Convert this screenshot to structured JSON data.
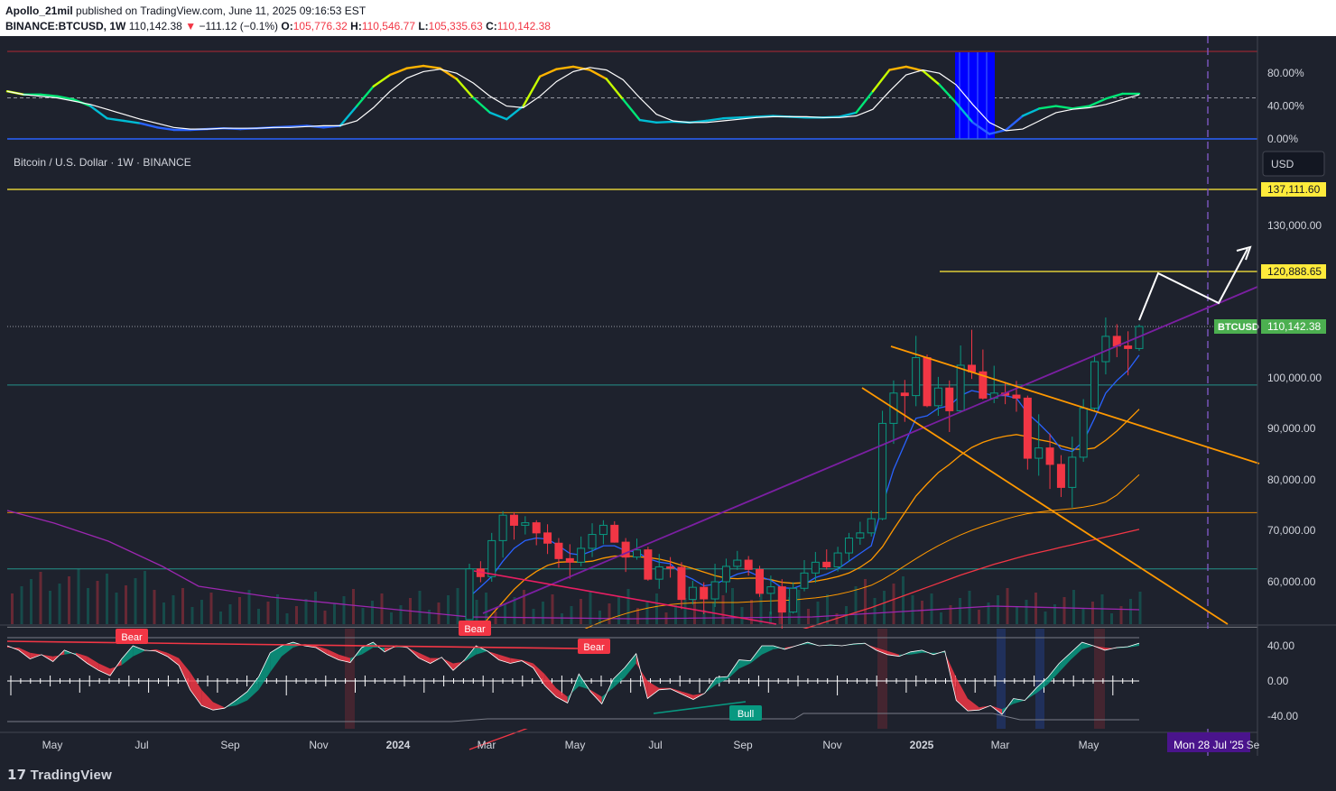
{
  "header": {
    "author": "Apollo_21mil",
    "published_text": "published on TradingView.com, June 11, 2025 09:16:53 EST",
    "symbol": "BINANCE:BTCUSD, 1W",
    "last": "110,142.38",
    "change_arrow": "▼",
    "change": "−111.12 (−0.1%)",
    "o_label": "O:",
    "o": "105,776.32",
    "h_label": "H:",
    "h": "110,546.77",
    "l_label": "L:",
    "l": "105,335.63",
    "c_label": "C:",
    "c": "110,142.38"
  },
  "main_legend": "Bitcoin / U.S. Dollar · 1W · BINANCE",
  "currency_button": "USD",
  "footer": {
    "brand": "TradingView"
  },
  "colors": {
    "background": "#1e222d",
    "up": "#089981",
    "down": "#f23645",
    "resistance_yellow": "#ffeb3b",
    "wedge_orange": "#ff9800",
    "trend_purple": "#9c27b0",
    "projection_white": "#ffffff"
  },
  "chart_data": [
    {
      "type": "line",
      "panel": "oscillator-top",
      "ylim": [
        0,
        100
      ],
      "y_ticks": [
        "80.00%",
        "40.00%",
        "0.00%"
      ],
      "series": [
        {
          "values": [
            58,
            54,
            54,
            52,
            48,
            40,
            25,
            22,
            19,
            14,
            11,
            11,
            12,
            13,
            12,
            13,
            14,
            15,
            16,
            14,
            16,
            40,
            64,
            78,
            86,
            89,
            86,
            73,
            50,
            32,
            24,
            40,
            76,
            85,
            88,
            84,
            73,
            48,
            23,
            20,
            21,
            20,
            22,
            25,
            26,
            27,
            28,
            27,
            26,
            26,
            27,
            32,
            58,
            84,
            88,
            83,
            66,
            44,
            20,
            6,
            11,
            28,
            37,
            40,
            37,
            40,
            49,
            55,
            55
          ]
        },
        {
          "values": [
            58,
            54,
            52,
            50,
            46,
            42,
            36,
            30,
            24,
            19,
            14,
            12,
            12,
            13,
            13,
            13,
            14,
            14,
            15,
            16,
            16,
            22,
            38,
            58,
            74,
            82,
            85,
            80,
            68,
            52,
            40,
            38,
            52,
            70,
            82,
            87,
            84,
            72,
            50,
            30,
            22,
            20,
            20,
            22,
            24,
            26,
            27,
            27,
            27,
            26,
            26,
            28,
            36,
            58,
            78,
            84,
            80,
            66,
            42,
            20,
            10,
            12,
            22,
            32,
            36,
            38,
            42,
            48,
            54
          ]
        }
      ]
    },
    {
      "type": "bar",
      "panel": "main-price",
      "title": "Bitcoin / U.S. Dollar · 1W · BINANCE",
      "ylim": [
        48000,
        143000
      ],
      "y_ticks": [
        "130,000.00",
        "100,000.00",
        "90,000.00",
        "80,000.00",
        "70,000.00",
        "60,000.00"
      ],
      "x_ticks": [
        "May",
        "Jul",
        "Sep",
        "Nov",
        "2024",
        "Mar",
        "May",
        "Jul",
        "Sep",
        "Nov",
        "2025",
        "Mar",
        "May",
        "Mon 28 Jul '25",
        "Se"
      ],
      "price_labels": [
        {
          "text": "137,111.60",
          "value": 137111.6
        },
        {
          "text": "120,888.65",
          "value": 120888.65
        },
        {
          "text": "110,142.38",
          "value": 110142.38,
          "ticker": "BTCUSD"
        }
      ],
      "horizontal_levels": [
        137111.6,
        120888.65,
        98600,
        73500,
        62500,
        51000
      ],
      "candles_open": [
        52500,
        62500,
        61000,
        68000,
        73000,
        71000,
        71500,
        69500,
        67500,
        64500,
        63800,
        66500,
        69200,
        71000,
        67700,
        64800,
        66200,
        60500,
        62900,
        62800,
        56500,
        58900,
        56600,
        60000,
        63000,
        64200,
        62400,
        57700,
        59000,
        54000,
        58700,
        61700,
        63800,
        62900,
        65600,
        68500,
        69500,
        72300,
        91000,
        97000,
        96500,
        104000,
        94500,
        98000,
        93500,
        102500,
        101200,
        96000,
        97000,
        96600,
        96000,
        84200,
        86200,
        83000,
        78500,
        84400,
        94000,
        103200,
        108200,
        106300,
        105800
      ],
      "candles_close": [
        62500,
        61000,
        68000,
        73000,
        71000,
        71500,
        69500,
        67500,
        64500,
        63800,
        66500,
        69200,
        71000,
        67700,
        64800,
        66200,
        60500,
        62900,
        62800,
        56500,
        58900,
        56600,
        60000,
        63000,
        64200,
        62400,
        57700,
        59000,
        54000,
        58700,
        61700,
        63800,
        62900,
        65600,
        68500,
        69500,
        72300,
        91000,
        97000,
        96500,
        104000,
        94500,
        98000,
        93500,
        102500,
        101200,
        96000,
        97000,
        96600,
        96000,
        84200,
        86200,
        83000,
        78500,
        84400,
        94000,
        103200,
        108200,
        106300,
        105800,
        110142
      ],
      "candles_high": [
        63500,
        64000,
        69500,
        73800,
        73600,
        72800,
        72000,
        71200,
        68500,
        67300,
        68800,
        71400,
        72000,
        71800,
        68500,
        68400,
        66800,
        65400,
        64800,
        63800,
        60200,
        59900,
        63500,
        64500,
        66000,
        65000,
        63100,
        61200,
        60500,
        59900,
        64200,
        65800,
        66300,
        66800,
        69500,
        71700,
        73900,
        93500,
        99500,
        99600,
        108300,
        104600,
        100200,
        99500,
        106400,
        109500,
        105600,
        102400,
        99200,
        99400,
        96500,
        92800,
        89000,
        84800,
        88400,
        95800,
        104200,
        111900,
        110600,
        109200,
        110547
      ],
      "candles_low": [
        49500,
        59900,
        60000,
        64700,
        68200,
        69200,
        67100,
        65400,
        62700,
        60600,
        63000,
        64800,
        67300,
        67600,
        61900,
        64300,
        60200,
        58600,
        60800,
        54600,
        55500,
        53600,
        55000,
        57800,
        62300,
        61200,
        57000,
        53500,
        49000,
        53700,
        58100,
        59800,
        62400,
        62000,
        63900,
        67200,
        68800,
        72000,
        87000,
        91300,
        94400,
        94200,
        92500,
        89300,
        93200,
        99800,
        95700,
        95000,
        94800,
        93300,
        82000,
        80800,
        78200,
        76600,
        74500,
        83500,
        93300,
        100700,
        104100,
        100500,
        105336
      ],
      "overlays": {
        "ema_blue": [
          57000,
          59000,
          61000,
          64000,
          66500,
          68000,
          68500,
          68300,
          67000,
          65500,
          65200,
          66000,
          67000,
          67000,
          66000,
          65800,
          64500,
          63800,
          63500,
          61500,
          60500,
          59200,
          59500,
          60500,
          61500,
          62000,
          61000,
          60300,
          58800,
          58700,
          59500,
          60800,
          61500,
          62500,
          64000,
          65500,
          67000,
          75000,
          82000,
          87000,
          92000,
          92500,
          94000,
          94500,
          96500,
          97500,
          97000,
          96500,
          96500,
          96000,
          93000,
          91000,
          88800,
          86000,
          85500,
          87500,
          92000,
          97000,
          99500,
          101500,
          104500
        ],
        "sma_orange": [
          48500,
          51000,
          53500,
          56000,
          58500,
          60500,
          62000,
          63200,
          63800,
          63900,
          63800,
          64000,
          64600,
          65000,
          65000,
          64900,
          64700,
          64400,
          63900,
          63200,
          62600,
          61900,
          61200,
          60700,
          60600,
          60700,
          60700,
          60400,
          59900,
          59700,
          59800,
          60100,
          60500,
          61000,
          61700,
          62800,
          64300,
          66800,
          70200,
          73500,
          76800,
          79200,
          81400,
          83000,
          84800,
          86300,
          87300,
          88000,
          88500,
          88800,
          88400,
          87800,
          87400,
          86600,
          86000,
          85900,
          86200,
          87700,
          89500,
          91600,
          93800
        ],
        "sma_orange2": [
          36000,
          37500,
          39000,
          40500,
          42000,
          43500,
          45000,
          46500,
          48000,
          49200,
          50300,
          51300,
          52200,
          53000,
          53700,
          54300,
          54800,
          55200,
          55500,
          55700,
          55800,
          55900,
          55900,
          55900,
          55900,
          56000,
          56100,
          56200,
          56300,
          56400,
          56600,
          56800,
          57100,
          57500,
          58000,
          58600,
          59300,
          60400,
          61700,
          63100,
          64500,
          65800,
          67000,
          68100,
          69100,
          70000,
          70800,
          71500,
          72200,
          72800,
          73300,
          73600,
          73900,
          74100,
          74300,
          74600,
          75000,
          75600,
          77000,
          79000,
          81000
        ],
        "sma_red": [
          27000,
          27800,
          28600,
          29400,
          30200,
          31000,
          31800,
          32600,
          33400,
          34200,
          35000,
          35800,
          36600,
          37400,
          38200,
          39000,
          39800,
          40600,
          41400,
          42200,
          43000,
          43800,
          44600,
          45400,
          46200,
          47000,
          47800,
          48600,
          49300,
          50000,
          50700,
          51400,
          52100,
          52800,
          53500,
          54200,
          54900,
          55700,
          56500,
          57300,
          58100,
          58900,
          59700,
          60500,
          61300,
          62000,
          62700,
          63400,
          64000,
          64600,
          65200,
          65700,
          66200,
          66700,
          67200,
          67700,
          68200,
          68700,
          69200,
          69700,
          70200
        ]
      }
    },
    {
      "type": "line",
      "panel": "oscillator-bottom",
      "ylim": [
        -50,
        50
      ],
      "y_ticks": [
        "40.00",
        "0.00",
        "-40.00"
      ],
      "labels": [
        {
          "text": "Bear",
          "color": "#f23645"
        },
        {
          "text": "Bear",
          "color": "#f23645"
        },
        {
          "text": "Bear",
          "color": "#f23645"
        },
        {
          "text": "Bull",
          "color": "#089981"
        }
      ],
      "series": [
        {
          "values": [
            40,
            35,
            25,
            30,
            22,
            35,
            30,
            20,
            12,
            6,
            25,
            40,
            35,
            34,
            28,
            18,
            -10,
            -28,
            -33,
            -31,
            -22,
            -12,
            5,
            32,
            40,
            44,
            40,
            38,
            30,
            24,
            21,
            38,
            44,
            33,
            40,
            38,
            26,
            20,
            27,
            12,
            24,
            40,
            34,
            24,
            20,
            23,
            15,
            -5,
            -18,
            -25,
            8,
            -12,
            -26,
            2,
            15,
            31,
            -20,
            -10,
            -9,
            -15,
            -21,
            -14,
            4,
            5,
            24,
            23,
            40,
            40,
            36,
            40,
            44,
            40,
            41,
            40,
            42,
            43,
            35,
            30,
            28,
            33,
            35,
            30,
            34,
            -22,
            -34,
            -33,
            -28,
            -38,
            -20,
            -22,
            -8,
            4,
            20,
            32,
            44,
            40,
            35,
            38,
            39,
            43
          ]
        },
        {
          "values": [
            38,
            38,
            32,
            30,
            28,
            30,
            32,
            28,
            20,
            14,
            18,
            28,
            34,
            36,
            32,
            26,
            10,
            -10,
            -24,
            -30,
            -28,
            -22,
            -10,
            10,
            28,
            38,
            42,
            40,
            36,
            30,
            26,
            30,
            38,
            38,
            38,
            38,
            32,
            26,
            26,
            20,
            22,
            30,
            34,
            30,
            26,
            24,
            20,
            8,
            -8,
            -18,
            -6,
            -10,
            -18,
            -8,
            4,
            20,
            0,
            -8,
            -8,
            -12,
            -16,
            -14,
            -4,
            2,
            14,
            20,
            30,
            36,
            38,
            40,
            42,
            40,
            40,
            40,
            41,
            42,
            38,
            34,
            30,
            30,
            32,
            32,
            32,
            4,
            -20,
            -30,
            -28,
            -32,
            -26,
            -22,
            -14,
            -4,
            10,
            24,
            36,
            40,
            38,
            37,
            38,
            40
          ]
        }
      ]
    }
  ]
}
